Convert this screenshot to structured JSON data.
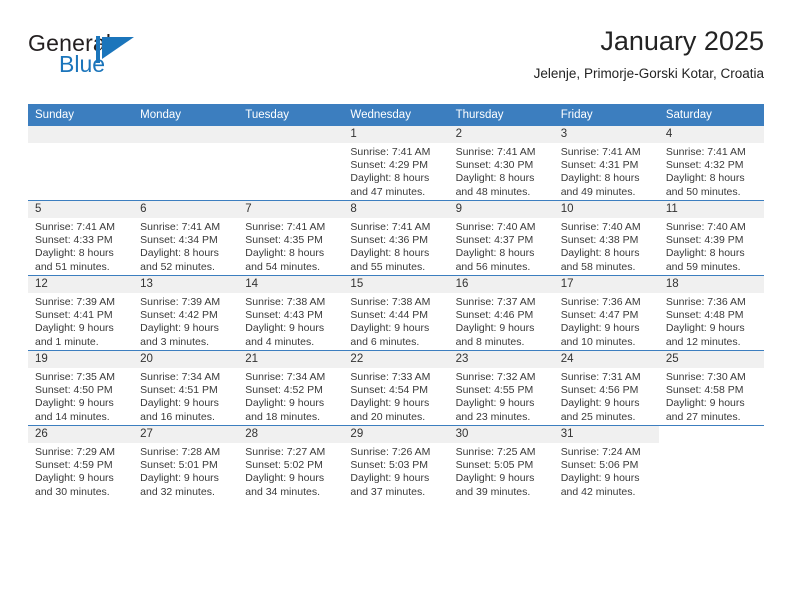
{
  "brand": {
    "name_part1": "General",
    "name_part2": "Blue",
    "accent_color": "#1b75bb"
  },
  "header": {
    "title": "January 2025",
    "subtitle": "Jelenje, Primorje-Gorski Kotar, Croatia"
  },
  "theme": {
    "header_band_color": "#3c7ebf",
    "daynum_band_color": "#f0f0f0",
    "row_divider_color": "#3c7ebf"
  },
  "weekday_headers": [
    "Sunday",
    "Monday",
    "Tuesday",
    "Wednesday",
    "Thursday",
    "Friday",
    "Saturday"
  ],
  "labels": {
    "sunrise_prefix": "Sunrise:",
    "sunset_prefix": "Sunset:",
    "daylight_prefix": "Daylight:"
  },
  "weeks": [
    [
      {
        "day": "",
        "type": "empty"
      },
      {
        "day": "",
        "type": "empty"
      },
      {
        "day": "",
        "type": "empty"
      },
      {
        "day": "1",
        "sunrise": "Sunrise: 7:41 AM",
        "sunset": "Sunset: 4:29 PM",
        "daylight_line1": "Daylight: 8 hours",
        "daylight_line2": "and 47 minutes."
      },
      {
        "day": "2",
        "sunrise": "Sunrise: 7:41 AM",
        "sunset": "Sunset: 4:30 PM",
        "daylight_line1": "Daylight: 8 hours",
        "daylight_line2": "and 48 minutes."
      },
      {
        "day": "3",
        "sunrise": "Sunrise: 7:41 AM",
        "sunset": "Sunset: 4:31 PM",
        "daylight_line1": "Daylight: 8 hours",
        "daylight_line2": "and 49 minutes."
      },
      {
        "day": "4",
        "sunrise": "Sunrise: 7:41 AM",
        "sunset": "Sunset: 4:32 PM",
        "daylight_line1": "Daylight: 8 hours",
        "daylight_line2": "and 50 minutes."
      }
    ],
    [
      {
        "day": "5",
        "sunrise": "Sunrise: 7:41 AM",
        "sunset": "Sunset: 4:33 PM",
        "daylight_line1": "Daylight: 8 hours",
        "daylight_line2": "and 51 minutes."
      },
      {
        "day": "6",
        "sunrise": "Sunrise: 7:41 AM",
        "sunset": "Sunset: 4:34 PM",
        "daylight_line1": "Daylight: 8 hours",
        "daylight_line2": "and 52 minutes."
      },
      {
        "day": "7",
        "sunrise": "Sunrise: 7:41 AM",
        "sunset": "Sunset: 4:35 PM",
        "daylight_line1": "Daylight: 8 hours",
        "daylight_line2": "and 54 minutes."
      },
      {
        "day": "8",
        "sunrise": "Sunrise: 7:41 AM",
        "sunset": "Sunset: 4:36 PM",
        "daylight_line1": "Daylight: 8 hours",
        "daylight_line2": "and 55 minutes."
      },
      {
        "day": "9",
        "sunrise": "Sunrise: 7:40 AM",
        "sunset": "Sunset: 4:37 PM",
        "daylight_line1": "Daylight: 8 hours",
        "daylight_line2": "and 56 minutes."
      },
      {
        "day": "10",
        "sunrise": "Sunrise: 7:40 AM",
        "sunset": "Sunset: 4:38 PM",
        "daylight_line1": "Daylight: 8 hours",
        "daylight_line2": "and 58 minutes."
      },
      {
        "day": "11",
        "sunrise": "Sunrise: 7:40 AM",
        "sunset": "Sunset: 4:39 PM",
        "daylight_line1": "Daylight: 8 hours",
        "daylight_line2": "and 59 minutes."
      }
    ],
    [
      {
        "day": "12",
        "sunrise": "Sunrise: 7:39 AM",
        "sunset": "Sunset: 4:41 PM",
        "daylight_line1": "Daylight: 9 hours",
        "daylight_line2": "and 1 minute."
      },
      {
        "day": "13",
        "sunrise": "Sunrise: 7:39 AM",
        "sunset": "Sunset: 4:42 PM",
        "daylight_line1": "Daylight: 9 hours",
        "daylight_line2": "and 3 minutes."
      },
      {
        "day": "14",
        "sunrise": "Sunrise: 7:38 AM",
        "sunset": "Sunset: 4:43 PM",
        "daylight_line1": "Daylight: 9 hours",
        "daylight_line2": "and 4 minutes."
      },
      {
        "day": "15",
        "sunrise": "Sunrise: 7:38 AM",
        "sunset": "Sunset: 4:44 PM",
        "daylight_line1": "Daylight: 9 hours",
        "daylight_line2": "and 6 minutes."
      },
      {
        "day": "16",
        "sunrise": "Sunrise: 7:37 AM",
        "sunset": "Sunset: 4:46 PM",
        "daylight_line1": "Daylight: 9 hours",
        "daylight_line2": "and 8 minutes."
      },
      {
        "day": "17",
        "sunrise": "Sunrise: 7:36 AM",
        "sunset": "Sunset: 4:47 PM",
        "daylight_line1": "Daylight: 9 hours",
        "daylight_line2": "and 10 minutes."
      },
      {
        "day": "18",
        "sunrise": "Sunrise: 7:36 AM",
        "sunset": "Sunset: 4:48 PM",
        "daylight_line1": "Daylight: 9 hours",
        "daylight_line2": "and 12 minutes."
      }
    ],
    [
      {
        "day": "19",
        "sunrise": "Sunrise: 7:35 AM",
        "sunset": "Sunset: 4:50 PM",
        "daylight_line1": "Daylight: 9 hours",
        "daylight_line2": "and 14 minutes."
      },
      {
        "day": "20",
        "sunrise": "Sunrise: 7:34 AM",
        "sunset": "Sunset: 4:51 PM",
        "daylight_line1": "Daylight: 9 hours",
        "daylight_line2": "and 16 minutes."
      },
      {
        "day": "21",
        "sunrise": "Sunrise: 7:34 AM",
        "sunset": "Sunset: 4:52 PM",
        "daylight_line1": "Daylight: 9 hours",
        "daylight_line2": "and 18 minutes."
      },
      {
        "day": "22",
        "sunrise": "Sunrise: 7:33 AM",
        "sunset": "Sunset: 4:54 PM",
        "daylight_line1": "Daylight: 9 hours",
        "daylight_line2": "and 20 minutes."
      },
      {
        "day": "23",
        "sunrise": "Sunrise: 7:32 AM",
        "sunset": "Sunset: 4:55 PM",
        "daylight_line1": "Daylight: 9 hours",
        "daylight_line2": "and 23 minutes."
      },
      {
        "day": "24",
        "sunrise": "Sunrise: 7:31 AM",
        "sunset": "Sunset: 4:56 PM",
        "daylight_line1": "Daylight: 9 hours",
        "daylight_line2": "and 25 minutes."
      },
      {
        "day": "25",
        "sunrise": "Sunrise: 7:30 AM",
        "sunset": "Sunset: 4:58 PM",
        "daylight_line1": "Daylight: 9 hours",
        "daylight_line2": "and 27 minutes."
      }
    ],
    [
      {
        "day": "26",
        "sunrise": "Sunrise: 7:29 AM",
        "sunset": "Sunset: 4:59 PM",
        "daylight_line1": "Daylight: 9 hours",
        "daylight_line2": "and 30 minutes."
      },
      {
        "day": "27",
        "sunrise": "Sunrise: 7:28 AM",
        "sunset": "Sunset: 5:01 PM",
        "daylight_line1": "Daylight: 9 hours",
        "daylight_line2": "and 32 minutes."
      },
      {
        "day": "28",
        "sunrise": "Sunrise: 7:27 AM",
        "sunset": "Sunset: 5:02 PM",
        "daylight_line1": "Daylight: 9 hours",
        "daylight_line2": "and 34 minutes."
      },
      {
        "day": "29",
        "sunrise": "Sunrise: 7:26 AM",
        "sunset": "Sunset: 5:03 PM",
        "daylight_line1": "Daylight: 9 hours",
        "daylight_line2": "and 37 minutes."
      },
      {
        "day": "30",
        "sunrise": "Sunrise: 7:25 AM",
        "sunset": "Sunset: 5:05 PM",
        "daylight_line1": "Daylight: 9 hours",
        "daylight_line2": "and 39 minutes."
      },
      {
        "day": "31",
        "sunrise": "Sunrise: 7:24 AM",
        "sunset": "Sunset: 5:06 PM",
        "daylight_line1": "Daylight: 9 hours",
        "daylight_line2": "and 42 minutes."
      },
      {
        "day": "",
        "type": "blank"
      }
    ]
  ]
}
